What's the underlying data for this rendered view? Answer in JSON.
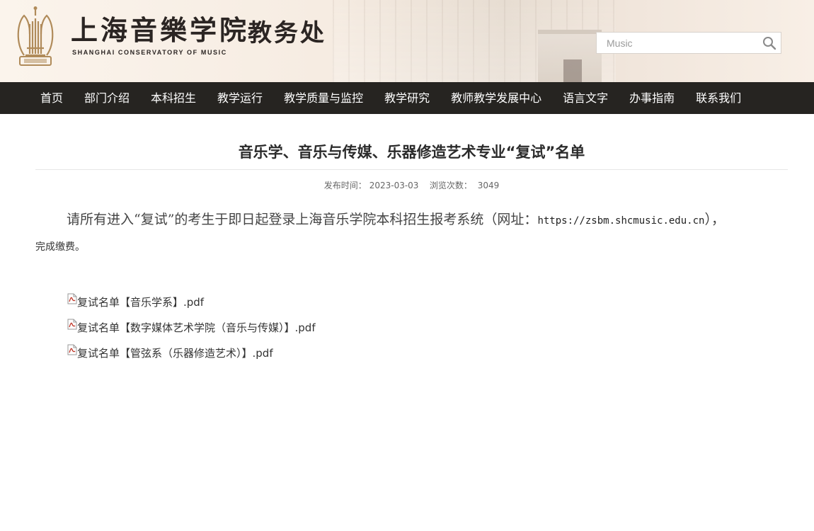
{
  "header": {
    "school_name_cn": "上海音樂学院",
    "school_name_en": "SHANGHAI CONSERVATORY OF MUSIC",
    "dept_name": "教务处",
    "search": {
      "placeholder": "Music",
      "value": ""
    }
  },
  "nav": {
    "items": [
      {
        "label": "首页"
      },
      {
        "label": "部门介绍"
      },
      {
        "label": "本科招生"
      },
      {
        "label": "教学运行"
      },
      {
        "label": "教学质量与监控"
      },
      {
        "label": "教学研究"
      },
      {
        "label": "教师教学发展中心"
      },
      {
        "label": "语言文字"
      },
      {
        "label": "办事指南"
      },
      {
        "label": "联系我们"
      }
    ]
  },
  "article": {
    "title": "音乐学、音乐与传媒、乐器修造艺术专业“复试”名单",
    "publish_label": "发布时间：",
    "publish_date": "2023-03-03",
    "views_label": "浏览次数：",
    "views": "3049",
    "body_part1": "请所有进入“复试”的考生于即日起登录上海音乐学院本科招生报考系统（网址：",
    "body_url": "https://zsbm.shcmusic.edu.cn",
    "body_part2": "），",
    "body_line2": "完成缴费。",
    "attachments": [
      {
        "label": "复试名单【音乐学系】.pdf",
        "icon": "pdf-icon"
      },
      {
        "label": "复试名单【数字媒体艺术学院（音乐与传媒）】.pdf",
        "icon": "pdf-icon"
      },
      {
        "label": "复试名单【管弦系（乐器修造艺术）】.pdf",
        "icon": "pdf-icon"
      }
    ]
  },
  "colors": {
    "nav_bg": "#262421",
    "nav_text": "#ffffff",
    "header_bg": "#f6ece2",
    "logo_gold": "#b08b5a",
    "pdf_red": "#c0392b"
  }
}
